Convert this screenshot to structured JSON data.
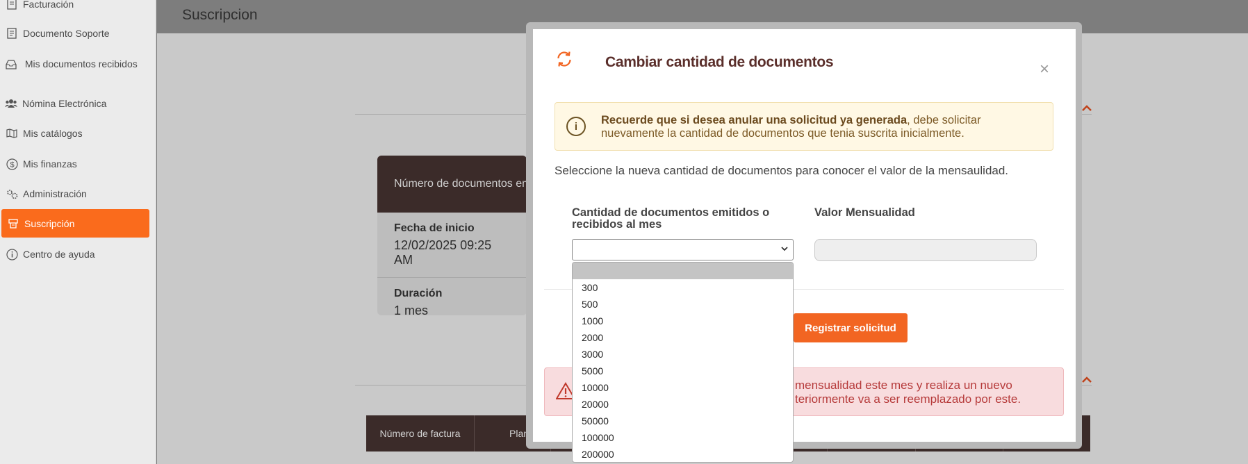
{
  "sidebar": {
    "items": [
      {
        "label": "Facturación",
        "icon": "invoice-icon"
      },
      {
        "label": "Documento Soporte",
        "icon": "document-icon"
      },
      {
        "label": "Mis documentos recibidos",
        "icon": "inbox-icon"
      },
      {
        "label": "Nómina Electrónica",
        "icon": "users-icon"
      },
      {
        "label": "Mis catálogos",
        "icon": "map-icon"
      },
      {
        "label": "Mis finanzas",
        "icon": "dollar-icon"
      },
      {
        "label": "Administración",
        "icon": "gears-icon"
      },
      {
        "label": "Suscripción",
        "icon": "subscription-icon",
        "active": true
      },
      {
        "label": "Centro de ayuda",
        "icon": "info-icon"
      }
    ]
  },
  "main": {
    "title": "Suscripcion",
    "card": {
      "header": "Número de documentos emi",
      "fields": [
        {
          "label": "Fecha de inicio",
          "value": "12/02/2025 09:25 AM"
        },
        {
          "label": "Duración",
          "value": "1 mes"
        }
      ]
    },
    "table_headers": [
      "Número de factura",
      "Plan"
    ]
  },
  "modal": {
    "title": "Cambiar cantidad de documentos",
    "close": "×",
    "notice_bold": "Recuerde que si desea anular una solicitud ya generada",
    "notice_rest": ", debe solicitar nuevamente la cantidad de documentos que tenia suscrita inicialmente.",
    "instructions": "Seleccione la nueva cantidad de documentos para conocer el valor de la mensaulidad.",
    "field_qty_label": "Cantidad de documentos emitidos o recibidos al mes",
    "field_value_label": "Valor Mensualidad",
    "select_value": "",
    "value_input": "",
    "register_button": "Registrar solicitud",
    "danger_line1": "mensualidad este mes y realiza un nuevo",
    "danger_line2": "teriormente va a ser reemplazado por este."
  },
  "dropdown": {
    "options": [
      "",
      "300",
      "500",
      "1000",
      "2000",
      "3000",
      "5000",
      "10000",
      "20000",
      "50000",
      "100000",
      "200000"
    ],
    "selected_index": 0
  },
  "colors": {
    "accent": "#f26522",
    "brand_dark": "#3b2b29",
    "title": "#5a2e2a"
  }
}
